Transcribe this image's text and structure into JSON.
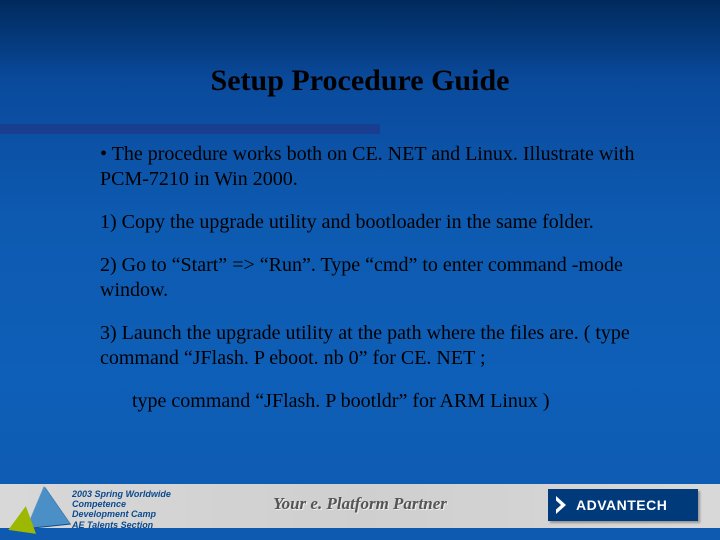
{
  "title": "Setup Procedure Guide",
  "bullets": {
    "intro": "• The procedure works both on CE. NET and Linux. Illustrate with PCM-7210 in Win 2000.",
    "step1": "1) Copy the upgrade utility and bootloader in the same folder.",
    "step2": "2) Go to “Start” => “Run”.  Type “cmd” to enter command -mode window.",
    "step3": "3) Launch the upgrade utility at the path where the files are. ( type command “JFlash. P eboot. nb 0” for CE. NET ;",
    "step3b": "type command “JFlash. P bootldr” for ARM Linux )"
  },
  "footer": {
    "camp_line1": "2003 Spring Worldwide",
    "camp_line2": "Competence Development Camp",
    "camp_line3": "AE Talents Section",
    "tagline": "Your e. Platform Partner",
    "brand": "ADVANTECH"
  }
}
